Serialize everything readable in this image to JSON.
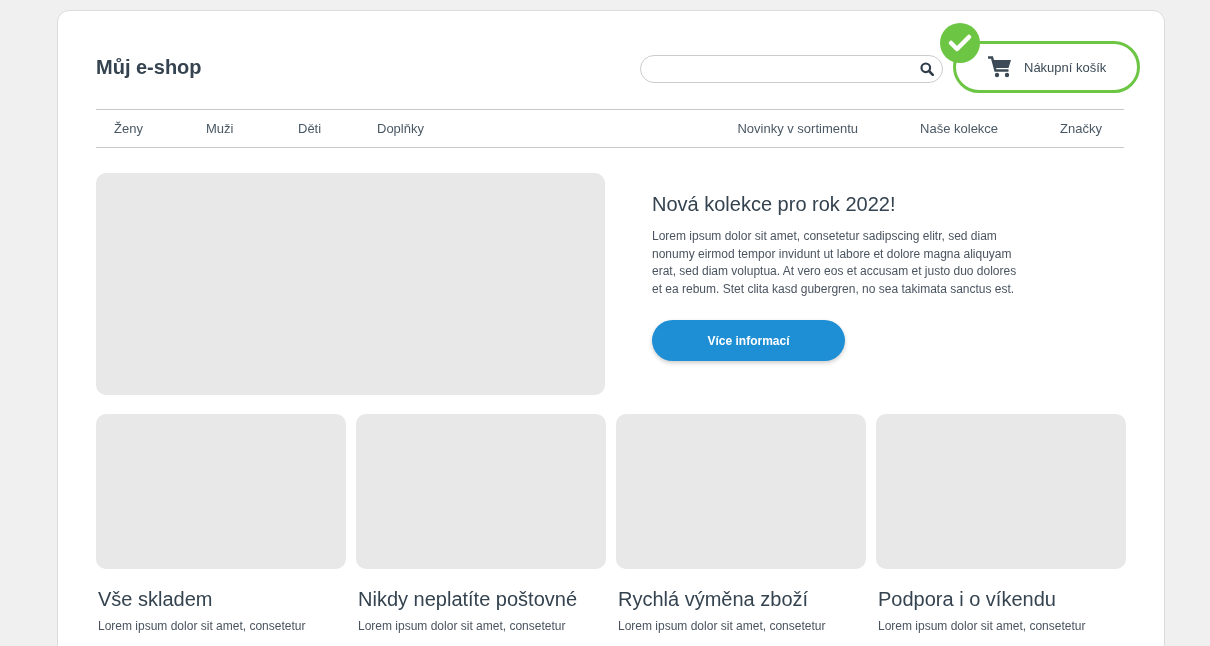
{
  "header": {
    "logo": "Můj e-shop",
    "cart": {
      "label": "Nákupní košík",
      "confirmed": true
    }
  },
  "nav": {
    "left": [
      {
        "label": "Ženy"
      },
      {
        "label": "Muži"
      },
      {
        "label": "Děti"
      },
      {
        "label": "Doplňky"
      }
    ],
    "right": [
      {
        "label": "Novinky v sortimentu"
      },
      {
        "label": "Naše kolekce"
      },
      {
        "label": "Značky"
      }
    ]
  },
  "hero": {
    "title": "Nová kolekce pro rok 2022!",
    "text": "Lorem ipsum dolor sit amet, consetetur sadipscing elitr, sed diam nonumy eirmod tempor invidunt ut labore et dolore magna aliquyam erat, sed diam voluptua. At vero eos et accusam et justo duo dolores et ea rebum. Stet clita kasd gubergren, no sea takimata sanctus est.",
    "button": "Více informací"
  },
  "features": [
    {
      "title": "Vše skladem",
      "text": "Lorem ipsum dolor sit amet, consetetur"
    },
    {
      "title": "Nikdy neplatíte poštovné",
      "text": "Lorem ipsum dolor sit amet, consetetur"
    },
    {
      "title": "Rychlá výměna zboží",
      "text": "Lorem ipsum dolor sit amet, consetetur"
    },
    {
      "title": "Podpora i o víkendu",
      "text": "Lorem ipsum dolor sit amet, consetetur"
    }
  ]
}
